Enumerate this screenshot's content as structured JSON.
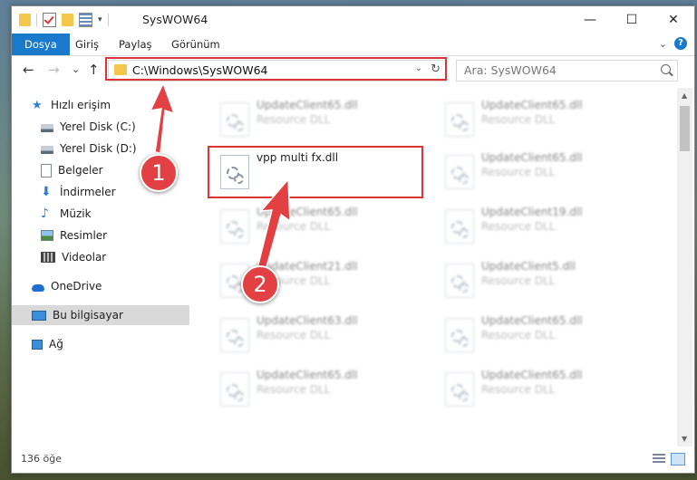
{
  "window": {
    "title": "SysWOW64",
    "controls": [
      "—",
      "☐",
      "✕"
    ]
  },
  "ribbon": {
    "tabs": [
      "Dosya",
      "Giriş",
      "Paylaş",
      "Görünüm"
    ],
    "help": "?"
  },
  "nav": {
    "back": "←",
    "forward": "→",
    "recent": "⌄",
    "up": "↑",
    "address": "C:\\Windows\\SysWOW64",
    "search_placeholder": "Ara: SysWOW64"
  },
  "sidebar": {
    "items": [
      {
        "label": "Hızlı erişim",
        "icon": "star-icon"
      },
      {
        "label": "Yerel Disk (C:)",
        "icon": "disk-icon",
        "pinned": true
      },
      {
        "label": "Yerel Disk (D:)",
        "icon": "disk-icon",
        "pinned": true
      },
      {
        "label": "Belgeler",
        "icon": "document-icon",
        "pinned": true
      },
      {
        "label": "İndirmeler",
        "icon": "download-icon",
        "pinned": true
      },
      {
        "label": "Müzik",
        "icon": "music-icon",
        "pinned": true
      },
      {
        "label": "Resimler",
        "icon": "pictures-icon",
        "pinned": true
      },
      {
        "label": "Videolar",
        "icon": "videos-icon",
        "pinned": true
      },
      {
        "label": "OneDrive",
        "icon": "cloud-icon"
      },
      {
        "label": "Bu bilgisayar",
        "icon": "computer-icon",
        "selected": true
      },
      {
        "label": "Ağ",
        "icon": "network-icon"
      }
    ]
  },
  "files": {
    "left": [
      {
        "name": "UpdateClient65.dll",
        "type": "Resource DLL"
      },
      {
        "name": "vpp multi fx.dll",
        "type": ""
      },
      {
        "name": "UpdateClient65.dll",
        "type": "Resource DLL"
      },
      {
        "name": "UpdateClient21.dll",
        "type": "Resource DLL"
      },
      {
        "name": "UpdateClient63.dll",
        "type": "Resource DLL"
      },
      {
        "name": "UpdateClient65.dll",
        "type": "Resource DLL"
      }
    ],
    "right": [
      {
        "name": "UpdateClient65.dll",
        "type": "Resource DLL"
      },
      {
        "name": "UpdateClient65.dll",
        "type": "Resource DLL"
      },
      {
        "name": "UpdateClient19.dll",
        "type": "Resource DLL"
      },
      {
        "name": "UpdateClient5.dll",
        "type": "Resource DLL"
      },
      {
        "name": "UpdateClient65.dll",
        "type": "Resource DLL"
      },
      {
        "name": "UpdateClient65.dll",
        "type": "Resource DLL"
      }
    ]
  },
  "status": {
    "item_count": "136 öğe"
  },
  "annotations": {
    "badge1": "1",
    "badge2": "2",
    "color": "#dd3438"
  },
  "colors": {
    "accent": "#1979ca"
  }
}
